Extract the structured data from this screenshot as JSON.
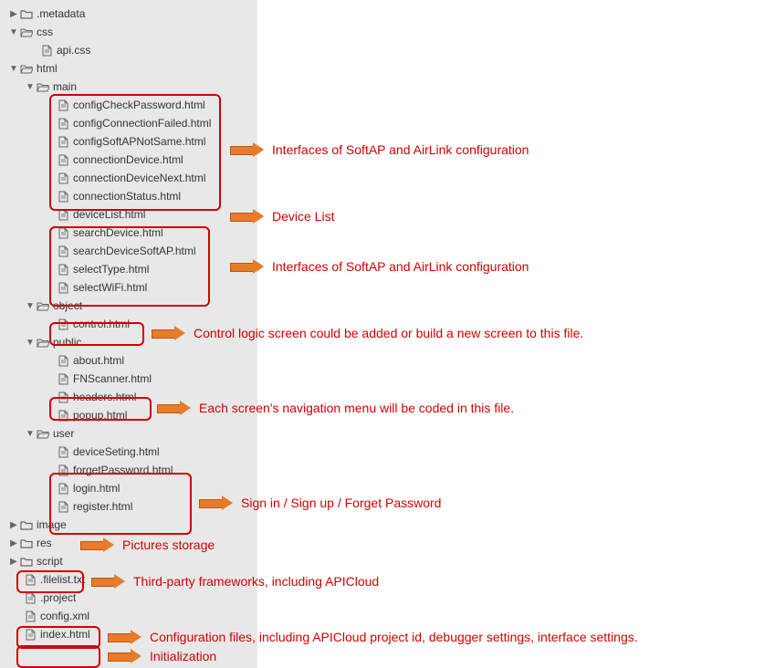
{
  "tree": {
    "metadata": ".metadata",
    "css": "css",
    "css_file": "api.css",
    "html": "html",
    "main": "main",
    "main_files": [
      "configCheckPassword.html",
      "configConnectionFailed.html",
      "configSoftAPNotSame.html",
      "connectionDevice.html",
      "connectionDeviceNext.html",
      "connectionStatus.html",
      "deviceList.html",
      "searchDevice.html",
      "searchDeviceSoftAP.html",
      "selectType.html",
      "selectWiFi.html"
    ],
    "object": "object",
    "object_files": [
      "control.html"
    ],
    "public": "public",
    "public_files": [
      "about.html",
      "FNScanner.html",
      "headers.html",
      "popup.html"
    ],
    "user": "user",
    "user_files": [
      "deviceSeting.html",
      "forgetPassword.html",
      "login.html",
      "register.html"
    ],
    "image": "image",
    "res": "res",
    "script": "script",
    "root_files": [
      ".filelist.txt",
      ".project",
      "config.xml",
      "index.html"
    ]
  },
  "annotations": {
    "a1": "Interfaces of SoftAP and AirLink configuration",
    "a2": "Device List",
    "a3": "Interfaces of SoftAP and AirLink configuration",
    "a4": "Control logic screen could be added or build a new screen to this file.",
    "a5": "Each screen's navigation menu will be coded in this file.",
    "a6": "Sign in / Sign up / Forget Password",
    "a7": "Pictures storage",
    "a8": "Third-party frameworks, including APICloud",
    "a9": "Configuration files, including APICloud project id, debugger settings, interface settings.",
    "a10": "Initialization"
  }
}
